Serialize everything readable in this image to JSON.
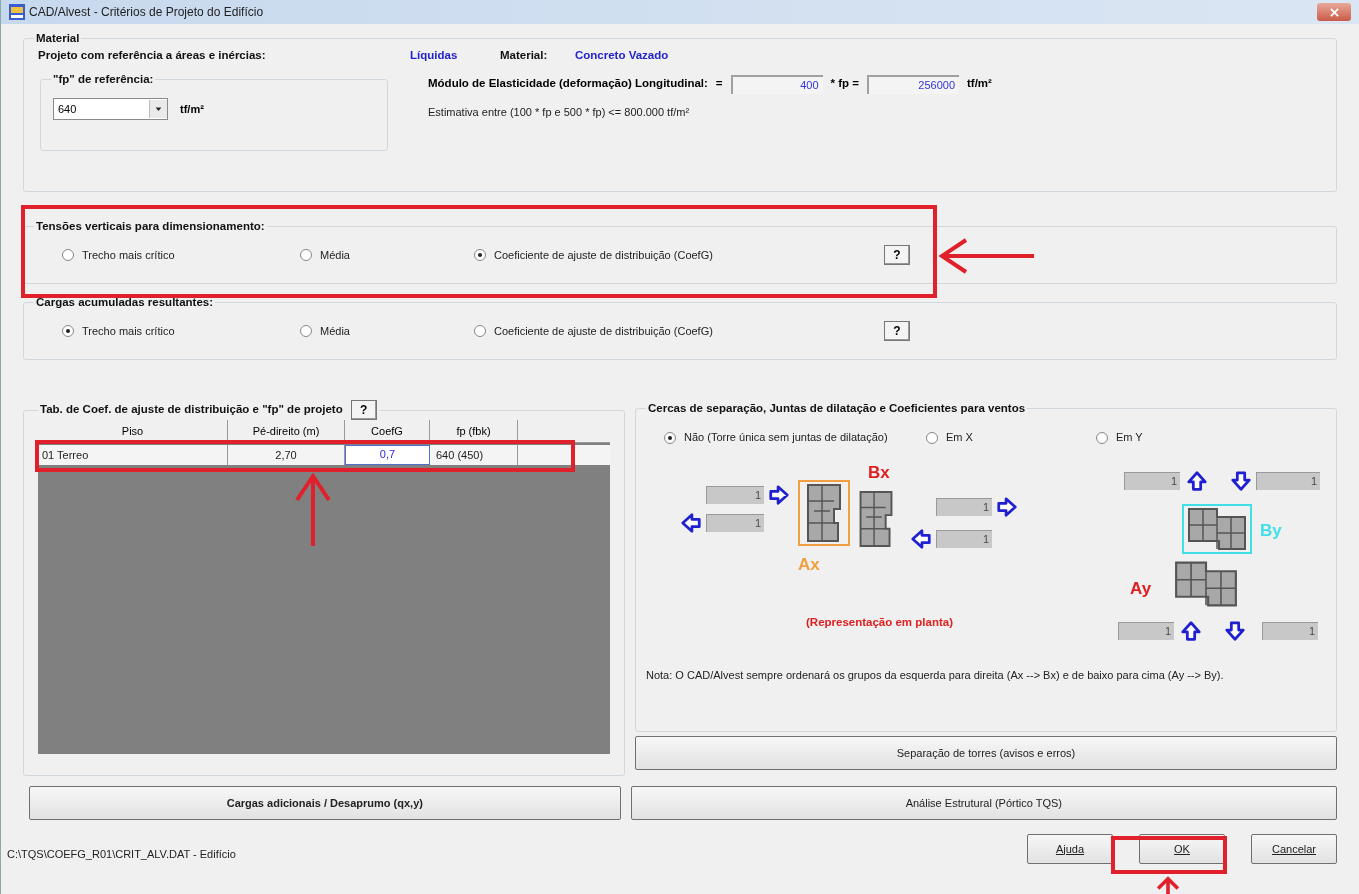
{
  "window": {
    "title": "CAD/Alvest - Critérios de Projeto do Edifício"
  },
  "material": {
    "legend": "Material",
    "reference_label": "Projeto com referência a áreas e inércias:",
    "reference_value": "Líquidas",
    "material_label": "Material:",
    "material_value": "Concreto Vazado",
    "fp_group": {
      "legend": "\"fp\" de referência:",
      "value": "640",
      "unit": "tf/m²"
    },
    "modulus": {
      "label": "Módulo de Elasticidade (deformação) Longitudinal:",
      "equals": "=",
      "factor": "400",
      "times_fp": "* fp =",
      "result": "256000",
      "unit": "tf/m²",
      "estimate": "Estimativa entre (100 * fp e 500 * fp) <= 800.000 tf/m²"
    }
  },
  "vertical_stresses": {
    "legend": "Tensões verticais para dimensionamento:",
    "help": "?",
    "options": [
      {
        "label": "Trecho mais crítico",
        "selected": false
      },
      {
        "label": "Média",
        "selected": false
      },
      {
        "label": "Coeficiente de ajuste de distribuição (CoefG)",
        "selected": true
      }
    ]
  },
  "accumulated_loads": {
    "legend": "Cargas acumuladas resultantes:",
    "help": "?",
    "options": [
      {
        "label": "Trecho mais crítico",
        "selected": true
      },
      {
        "label": "Média",
        "selected": false
      },
      {
        "label": "Coeficiente de ajuste de distribuição (CoefG)",
        "selected": false
      }
    ]
  },
  "coef_table": {
    "legend": "Tab. de Coef. de ajuste de distribuição  e \"fp\" de projeto",
    "help": "?",
    "columns": [
      "Piso",
      "Pé-direito (m)",
      "CoefG",
      "fp (fbk)"
    ],
    "rows": [
      {
        "cells": [
          {
            "text": "01 Terreo",
            "editing": false
          },
          {
            "text": "2,70",
            "editing": false
          },
          {
            "text": "0,7",
            "editing": true
          },
          {
            "text": "640  (450)",
            "editing": false
          }
        ]
      }
    ]
  },
  "separation": {
    "legend": "Cercas de separação, Juntas de dilatação e Coeficientes para ventos",
    "options": [
      {
        "label": "Não (Torre única sem juntas de dilatação)",
        "selected": true
      },
      {
        "label": "Em X",
        "selected": false
      },
      {
        "label": "Em Y",
        "selected": false
      }
    ],
    "labels": {
      "bx": "Bx",
      "ax": "Ax",
      "by": "By",
      "ay": "Ay"
    },
    "fields": [
      "1",
      "1",
      "1",
      "1",
      "1",
      "1",
      "1",
      "1"
    ],
    "caption": "(Representação em planta)",
    "note": "Nota:  O CAD/Alvest sempre ordenará os grupos da esquerda para direita (Ax --> Bx) e de baixo para cima (Ay --> By).",
    "button": "Separação de torres (avisos e erros)"
  },
  "buttons": {
    "additional_loads": "Cargas adicionais / Desaprumo (qx,y)",
    "structural_analysis": "Análise Estrutural (Pórtico TQS)"
  },
  "status_path": "C:\\TQS\\COEFG_R01\\CRIT_ALV.DAT - Edifício",
  "dialog_buttons": [
    "Ajuda",
    "OK",
    "Cancelar"
  ]
}
